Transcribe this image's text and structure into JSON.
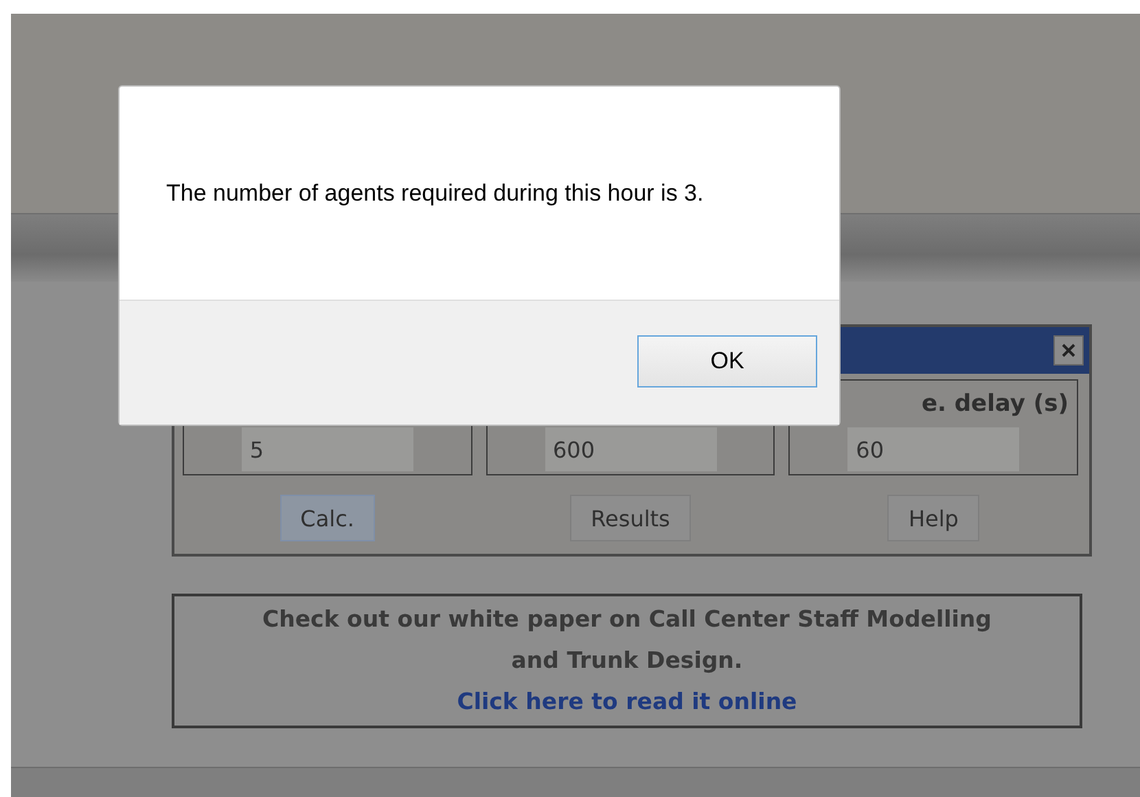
{
  "dialog": {
    "message": "The number of agents required during this hour is 3.",
    "button": "OK"
  },
  "calculator": {
    "labels": [
      "e. delay (s)"
    ],
    "inputs": [
      "5",
      "600",
      "60"
    ],
    "buttons": [
      {
        "label": "Calc.",
        "selected": true
      },
      {
        "label": "Results",
        "selected": false
      },
      {
        "label": "Help",
        "selected": false
      }
    ]
  },
  "promo": {
    "lines": [
      "Check out our white paper on Call Center Staff Modelling and Trunk Design."
    ],
    "link": "Click here to read it online"
  }
}
